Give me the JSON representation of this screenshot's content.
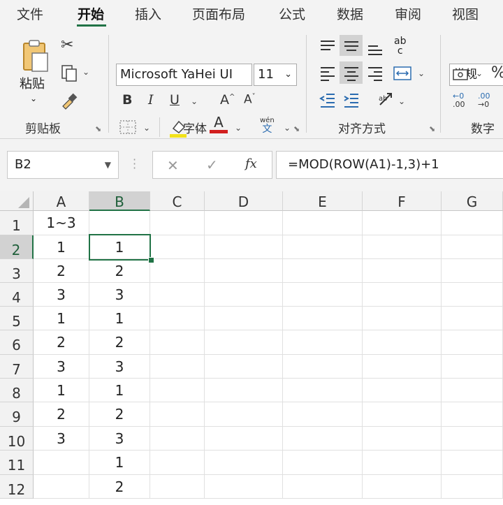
{
  "ribbon_tabs": [
    {
      "label": "文件"
    },
    {
      "label": "开始"
    },
    {
      "label": "插入"
    },
    {
      "label": "页面布局"
    },
    {
      "label": "公式"
    },
    {
      "label": "数据"
    },
    {
      "label": "审阅"
    },
    {
      "label": "视图"
    }
  ],
  "active_tab": "开始",
  "clipboard": {
    "paste_label": "粘贴",
    "group_label": "剪贴板"
  },
  "font": {
    "group_label": "字体",
    "font_name": "Microsoft YaHei UI",
    "font_size": "11",
    "bold": "B",
    "italic": "I",
    "underline": "U",
    "grow": "A",
    "shrink": "A",
    "font_color": "A",
    "phonetic_top": "wén",
    "phonetic_bottom": "文",
    "font_color_bar": "#d21f1f",
    "fill_color_bar": "#f2e21a"
  },
  "alignment": {
    "group_label": "对齐方式",
    "wrap_top": "ab",
    "wrap_bottom": "c"
  },
  "number": {
    "group_label": "数字",
    "format": "常规",
    "percent": "%"
  },
  "formula_bar": {
    "name_box": "B2",
    "cancel": "✕",
    "enter": "✓",
    "fx": "fx",
    "formula": "=MOD(ROW(A1)-1,3)+1"
  },
  "columns": [
    "A",
    "B",
    "C",
    "D",
    "E",
    "F",
    "G"
  ],
  "selected_column": "B",
  "selected_row": "2",
  "rows": [
    {
      "num": "1",
      "A": "1~3",
      "B": ""
    },
    {
      "num": "2",
      "A": "1",
      "B": "1"
    },
    {
      "num": "3",
      "A": "2",
      "B": "2"
    },
    {
      "num": "4",
      "A": "3",
      "B": "3"
    },
    {
      "num": "5",
      "A": "1",
      "B": "1"
    },
    {
      "num": "6",
      "A": "2",
      "B": "2"
    },
    {
      "num": "7",
      "A": "3",
      "B": "3"
    },
    {
      "num": "8",
      "A": "1",
      "B": "1"
    },
    {
      "num": "9",
      "A": "2",
      "B": "2"
    },
    {
      "num": "10",
      "A": "3",
      "B": "3"
    },
    {
      "num": "11",
      "A": "",
      "B": "1"
    },
    {
      "num": "12",
      "A": "",
      "B": "2"
    }
  ],
  "accent_color": "#217346"
}
